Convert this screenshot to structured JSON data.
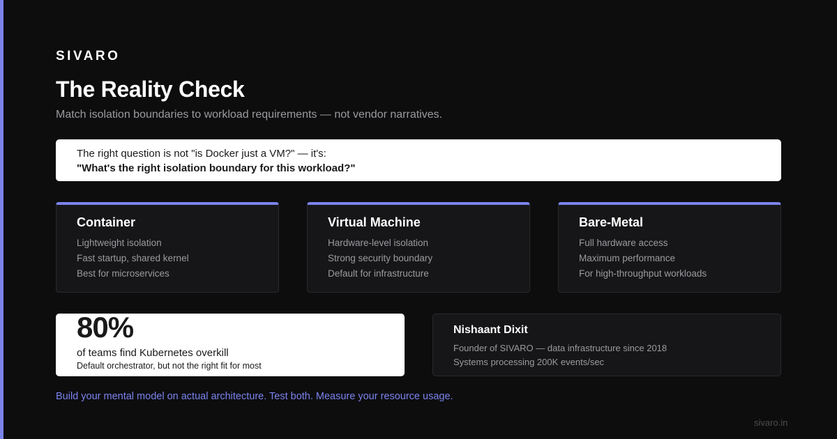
{
  "colors": {
    "background": "#0d0d0e",
    "accent": "#7b83eb",
    "card": "#161618",
    "muted_text": "#9b9ba0"
  },
  "brand": "SIVARO",
  "title": "The Reality Check",
  "subtitle": "Match isolation boundaries to workload requirements — not vendor narratives.",
  "question": {
    "line1": "The right question is not \"is Docker just a VM?\" — it's:",
    "line2": "\"What's the right isolation boundary for this workload?\""
  },
  "cards": [
    {
      "title": "Container",
      "lines": [
        "Lightweight isolation",
        "Fast startup, shared kernel",
        "Best for microservices"
      ]
    },
    {
      "title": "Virtual Machine",
      "lines": [
        "Hardware-level isolation",
        "Strong security boundary",
        "Default for infrastructure"
      ]
    },
    {
      "title": "Bare-Metal",
      "lines": [
        "Full hardware access",
        "Maximum performance",
        "For high-throughput workloads"
      ]
    }
  ],
  "stat": {
    "value": "80%",
    "label": "of teams find Kubernetes overkill",
    "note": "Default orchestrator, but not the right fit for most"
  },
  "author": {
    "name": "Nishaant Dixit",
    "lines": [
      "Founder of SIVARO — data infrastructure since 2018",
      "Systems processing 200K events/sec"
    ]
  },
  "cta": "Build your mental model on actual architecture. Test both. Measure your resource usage.",
  "footer_url": "sivaro.in"
}
